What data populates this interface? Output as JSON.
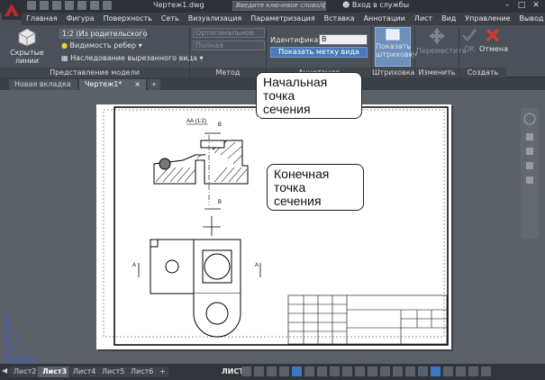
{
  "window": {
    "doc_title": "Чертеж1.dwg",
    "search_placeholder": "Введите ключевое слово/фразу",
    "login_label": "Вход в службы"
  },
  "ribbon_tabs": [
    "Главная",
    "Фигура",
    "Поверхность",
    "Сеть",
    "Визуализация",
    "Параметризация",
    "Вставка",
    "Аннотации",
    "Лист",
    "Вид",
    "Управление",
    "Вывод"
  ],
  "ribbon": {
    "hidden_lines_label": "Скрытые линии",
    "scale_combo": "1:2 (Из родительского",
    "edge_visibility_label": "Видимость ребер",
    "cut_view_inherit_label": "Наследование вырезанного вида",
    "panel_model_view": "Представление модели",
    "orthogonal_combo": "Ортогональное",
    "full_combo": "Полная",
    "panel_method": "Метод",
    "identifier_label": "Идентификатор",
    "identifier_value": "B",
    "show_view_label_button": "Показать метку вида",
    "panel_annotation": "Аннотация",
    "show_hatch_button_line1": "Показать",
    "show_hatch_button_line2": "штриховку",
    "panel_hatch": "Штриховка",
    "move_button": "Переместить",
    "panel_modify": "Изменить",
    "ok_button": "ОК",
    "cancel_button": "Отмена",
    "panel_create": "Создать"
  },
  "doc_tabs": [
    "Новая вкладка",
    "Чертеж1*"
  ],
  "drawing": {
    "section_label": "АА (1:2)",
    "mark_b_top": "B",
    "mark_b_bottom": "B",
    "mark_a_left": "A",
    "mark_a_right": "A"
  },
  "callouts": {
    "start_point": [
      "Начальная",
      "точка",
      "сечения"
    ],
    "end_point": [
      "Конечная",
      "точка",
      "сечения"
    ]
  },
  "layout_tabs": [
    "Лист2",
    "Лист3",
    "Лист4",
    "Лист5",
    "Лист6"
  ],
  "status": {
    "sheet_mode": "ЛИСТ"
  },
  "colors": {
    "accent_blue": "#4a7bb7",
    "cancel_red": "#d23a2e",
    "ucs_blue": "#3c5fd8"
  }
}
